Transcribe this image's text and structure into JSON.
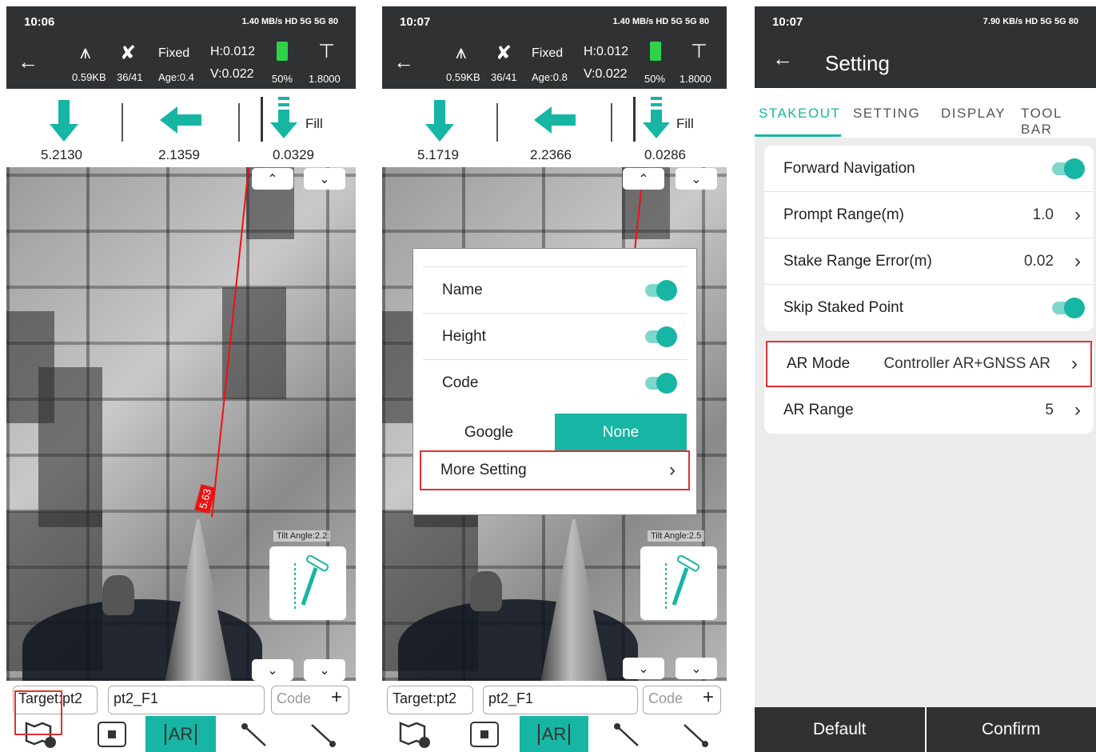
{
  "colors": {
    "accent": "#17b5a3",
    "dark_bar": "#2f3133",
    "highlight": "#e03030"
  },
  "panel1": {
    "time": "10:06",
    "status_icons": "1.40 MB/s HD 5G 5G 80",
    "fix": "Fixed",
    "h": "H:0.012",
    "v": "V:0.022",
    "data_rate": "0.59KB",
    "sats": "36/41",
    "age": "Age:0.4",
    "battery": "50%",
    "height": "1.8000",
    "nav": {
      "down": "5.2130",
      "left": "2.1359",
      "fill": "0.0329",
      "fill_label": "Fill"
    },
    "distance_tag": "5.63",
    "tilt": "Tilt Angle:2.2",
    "target": "Target:pt2",
    "point_name": "pt2_F1",
    "code_placeholder": "Code",
    "ar_label": "AR"
  },
  "panel2": {
    "time": "10:07",
    "status_icons": "1.40 MB/s HD 5G 5G 80",
    "fix": "Fixed",
    "h": "H:0.012",
    "v": "V:0.022",
    "data_rate": "0.59KB",
    "sats": "36/41",
    "age": "Age:0.8",
    "battery": "50%",
    "height": "1.8000",
    "nav": {
      "down": "5.1719",
      "left": "2.2366",
      "fill": "0.0286",
      "fill_label": "Fill"
    },
    "tilt": "Tilt Angle:2.5",
    "target": "Target:pt2",
    "point_name": "pt2_F1",
    "code_placeholder": "Code",
    "ar_label": "AR",
    "popup": {
      "rows": [
        "Name",
        "Height",
        "Code"
      ],
      "map_options": [
        "Google",
        "None"
      ],
      "map_selected": "None",
      "more": "More Setting"
    }
  },
  "panel3": {
    "time": "10:07",
    "status_icons": "7.90 KB/s HD 5G 5G 80",
    "title": "Setting",
    "tabs": [
      "STAKEOUT",
      "SETTING",
      "DISPLAY",
      "TOOL BAR"
    ],
    "active_tab": "STAKEOUT",
    "rows1": [
      {
        "label": "Forward Navigation",
        "toggle": true
      },
      {
        "label": "Prompt Range(m)",
        "value": "1.0"
      },
      {
        "label": "Stake Range Error(m)",
        "value": "0.02"
      },
      {
        "label": "Skip Staked Point",
        "toggle": true
      }
    ],
    "rows2": [
      {
        "label": "AR Mode",
        "value": "Controller AR+GNSS AR"
      },
      {
        "label": "AR Range",
        "value": "5"
      }
    ],
    "footer": {
      "default": "Default",
      "confirm": "Confirm"
    }
  }
}
